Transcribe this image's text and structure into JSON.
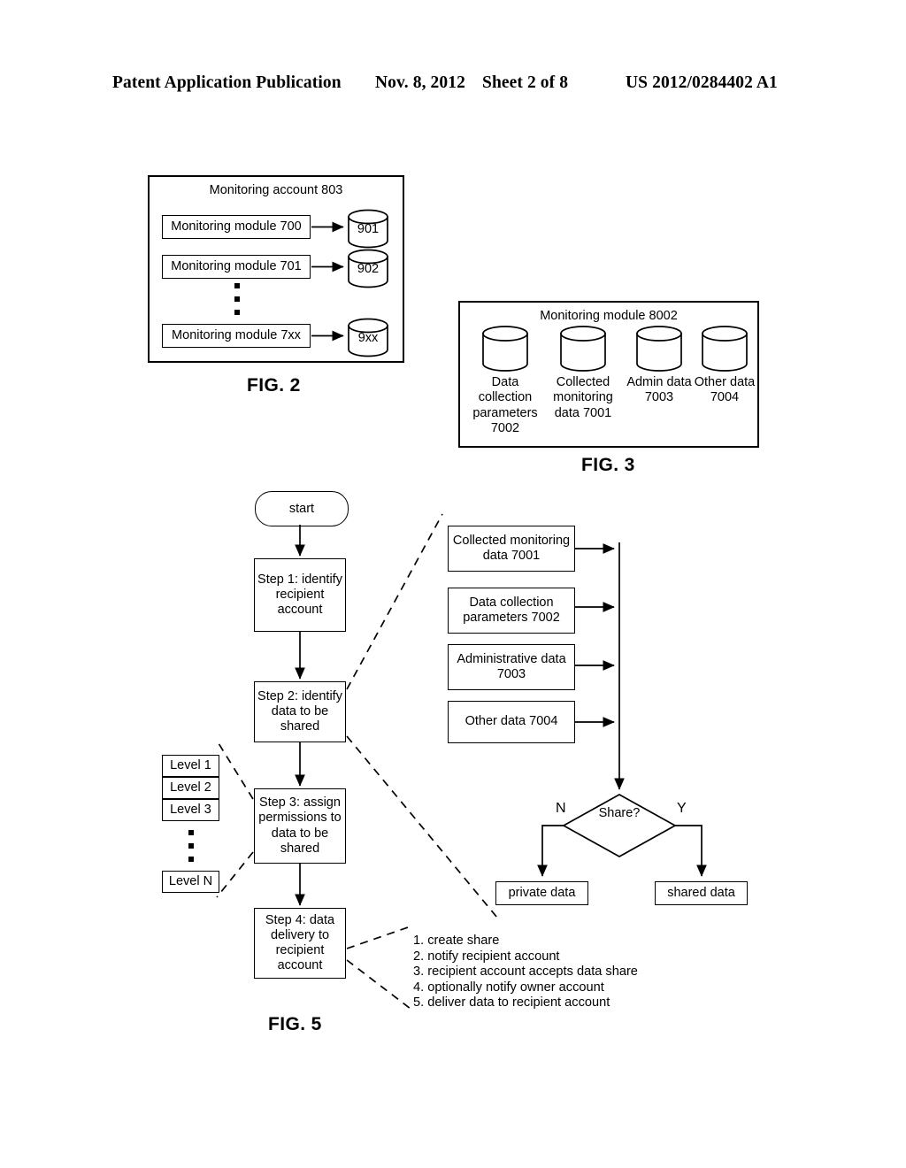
{
  "header": {
    "publication": "Patent Application Publication",
    "date": "Nov. 8, 2012",
    "sheet": "Sheet 2 of 8",
    "number": "US 2012/0284402 A1"
  },
  "figures": {
    "fig2": {
      "label": "FIG. 2",
      "title": "Monitoring account 803",
      "modules": [
        {
          "label": "Monitoring module 700",
          "db": "901"
        },
        {
          "label": "Monitoring module 701",
          "db": "902"
        },
        {
          "label": "Monitoring module 7xx",
          "db": "9xx"
        }
      ],
      "ellipsis": "vertical-dots"
    },
    "fig3": {
      "label": "FIG. 3",
      "title": "Monitoring module 8002",
      "stores": [
        {
          "caption": "Data collection parameters 7002"
        },
        {
          "caption": "Collected monitoring data 7001"
        },
        {
          "caption": "Admin data 7003"
        },
        {
          "caption": "Other data 7004"
        }
      ]
    },
    "fig5": {
      "label": "FIG. 5",
      "start": "start",
      "steps": [
        {
          "label": "Step 1: identify recipient account"
        },
        {
          "label": "Step 2: identify data to be shared"
        },
        {
          "label": "Step 3: assign permissions to data to be shared"
        },
        {
          "label": "Step 4: data delivery to recipient account"
        }
      ],
      "levels": [
        "Level 1",
        "Level 2",
        "Level 3",
        "Level N"
      ],
      "levels_ellipsis": "vertical-dots",
      "data_items": [
        "Collected monitoring data 7001",
        "Data collection parameters 7002",
        "Administrative data 7003",
        "Other data 7004"
      ],
      "decision": {
        "label": "Share?",
        "no_branch": "N",
        "yes_branch": "Y",
        "no_result": "private data",
        "yes_result": "shared data"
      },
      "delivery_steps": [
        "1. create share",
        "2. notify recipient account",
        "3. recipient account accepts data share",
        "4. optionally notify owner account",
        "5. deliver data to recipient account"
      ]
    }
  }
}
